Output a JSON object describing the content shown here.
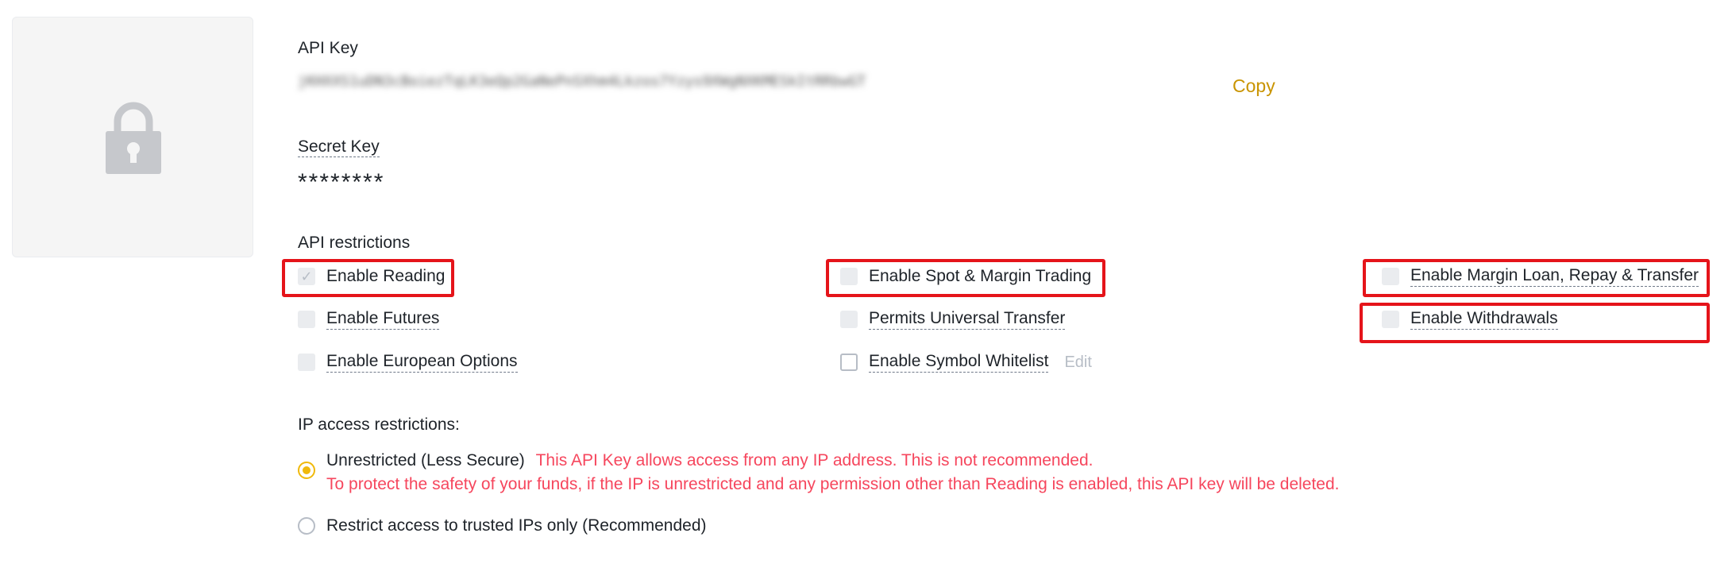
{
  "api_key": {
    "label": "API Key",
    "value": "jKHXXS1uDN3cBoiezTqLK3eQp2GaNePnSXhm4Lkzos7Yzys9XWgNXKMESkItRRbwGT",
    "copy_label": "Copy"
  },
  "secret_key": {
    "label": "Secret Key",
    "value": "********"
  },
  "api_restrictions": {
    "label": "API restrictions",
    "options": [
      {
        "label": "Enable Reading",
        "checked": true
      },
      {
        "label": "Enable Spot & Margin Trading",
        "checked": false
      },
      {
        "label": "Enable Margin Loan, Repay & Transfer",
        "checked": false
      },
      {
        "label": "Enable Futures",
        "checked": false
      },
      {
        "label": "Permits Universal Transfer",
        "checked": false
      },
      {
        "label": "Enable Withdrawals",
        "checked": false
      },
      {
        "label": "Enable European Options",
        "checked": false
      },
      {
        "label": "Enable Symbol Whitelist",
        "checked": false
      }
    ],
    "edit_label": "Edit"
  },
  "ip_restrictions": {
    "label": "IP access restrictions:",
    "unrestricted": {
      "label": "Unrestricted (Less Secure)",
      "selected": true,
      "warning_1": "This API Key allows access from any IP address. This is not recommended.",
      "warning_2": "To protect the safety of your funds, if the IP is unrestricted and any permission other than Reading is enabled, this API key will be deleted."
    },
    "restricted": {
      "label": "Restrict access to trusted IPs only (Recommended)",
      "selected": false
    }
  },
  "colors": {
    "accent": "#f0b90b",
    "copy": "#c99400",
    "warning": "#f6465d",
    "highlight": "#e5141a"
  }
}
